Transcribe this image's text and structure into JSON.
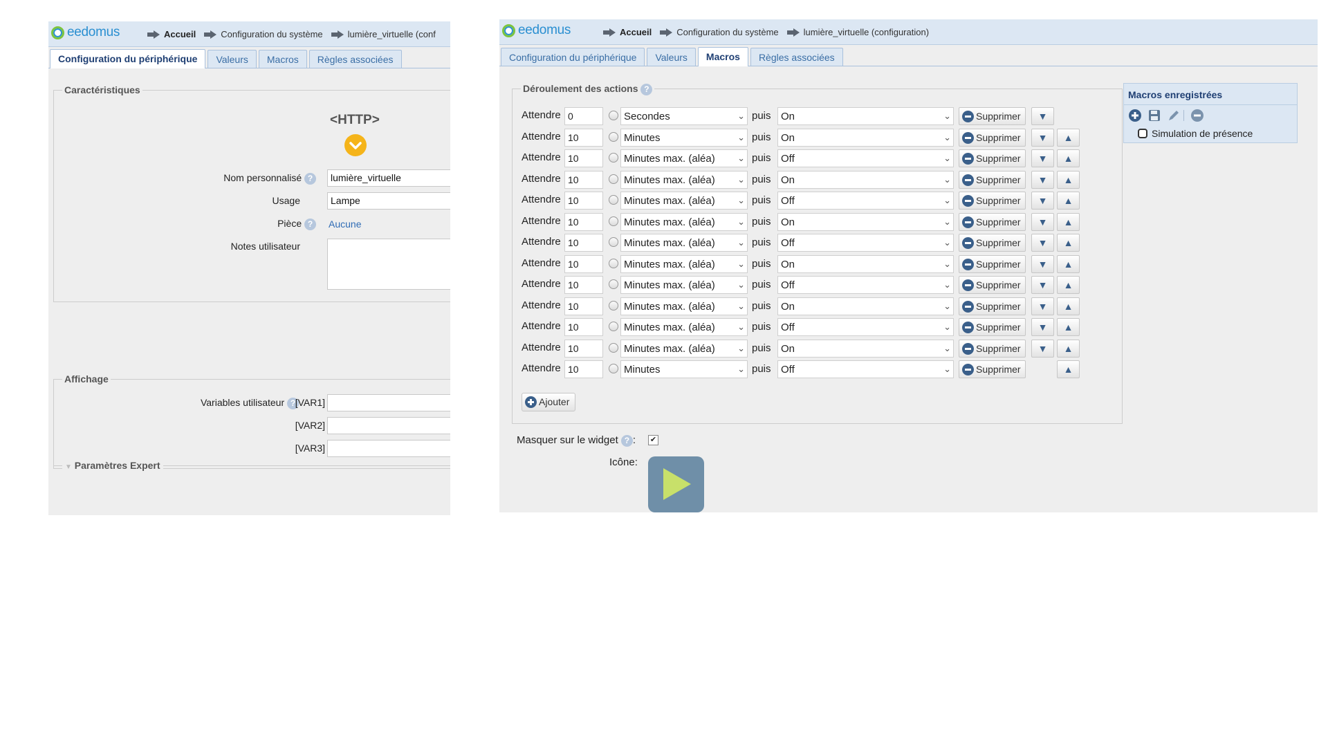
{
  "left": {
    "logo": "eedomus",
    "breadcrumbs": [
      "Accueil",
      "Configuration du système",
      "lumière_virtuelle (conf"
    ],
    "tabs": [
      "Configuration du périphérique",
      "Valeurs",
      "Macros",
      "Règles associées"
    ],
    "active_tab": 0,
    "section_characteristics": "Caractéristiques",
    "device_type": "<HTTP>",
    "fields": {
      "nom_label": "Nom personnalisé",
      "nom_value": "lumière_virtuelle",
      "usage_label": "Usage",
      "usage_value": "Lampe",
      "piece_label": "Pièce",
      "piece_value": "Aucune",
      "notes_label": "Notes utilisateur",
      "notes_value": ""
    },
    "section_display": "Affichage",
    "variables_label": "Variables utilisateur",
    "vars": [
      "[VAR1]",
      "[VAR2]",
      "[VAR3]"
    ],
    "expert_label": "Paramètres Expert",
    "help_glyph": "?"
  },
  "right": {
    "logo": "eedomus",
    "breadcrumbs": [
      "Accueil",
      "Configuration du système",
      "lumière_virtuelle (configuration)"
    ],
    "tabs": [
      "Configuration du périphérique",
      "Valeurs",
      "Macros",
      "Règles associées"
    ],
    "active_tab": 2,
    "section_actions": "Déroulement des actions",
    "actions": [
      {
        "wait": "Attendre",
        "value": "0",
        "unit": "Secondes",
        "then": "puis",
        "state": "On",
        "delete": "Supprimer",
        "down": true,
        "up": false
      },
      {
        "wait": "Attendre",
        "value": "10",
        "unit": "Minutes",
        "then": "puis",
        "state": "On",
        "delete": "Supprimer",
        "down": true,
        "up": true
      },
      {
        "wait": "Attendre",
        "value": "10",
        "unit": "Minutes max. (aléa)",
        "then": "puis",
        "state": "Off",
        "delete": "Supprimer",
        "down": true,
        "up": true
      },
      {
        "wait": "Attendre",
        "value": "10",
        "unit": "Minutes max. (aléa)",
        "then": "puis",
        "state": "On",
        "delete": "Supprimer",
        "down": true,
        "up": true
      },
      {
        "wait": "Attendre",
        "value": "10",
        "unit": "Minutes max. (aléa)",
        "then": "puis",
        "state": "Off",
        "delete": "Supprimer",
        "down": true,
        "up": true
      },
      {
        "wait": "Attendre",
        "value": "10",
        "unit": "Minutes max. (aléa)",
        "then": "puis",
        "state": "On",
        "delete": "Supprimer",
        "down": true,
        "up": true
      },
      {
        "wait": "Attendre",
        "value": "10",
        "unit": "Minutes max. (aléa)",
        "then": "puis",
        "state": "Off",
        "delete": "Supprimer",
        "down": true,
        "up": true
      },
      {
        "wait": "Attendre",
        "value": "10",
        "unit": "Minutes max. (aléa)",
        "then": "puis",
        "state": "On",
        "delete": "Supprimer",
        "down": true,
        "up": true
      },
      {
        "wait": "Attendre",
        "value": "10",
        "unit": "Minutes max. (aléa)",
        "then": "puis",
        "state": "Off",
        "delete": "Supprimer",
        "down": true,
        "up": true
      },
      {
        "wait": "Attendre",
        "value": "10",
        "unit": "Minutes max. (aléa)",
        "then": "puis",
        "state": "On",
        "delete": "Supprimer",
        "down": true,
        "up": true
      },
      {
        "wait": "Attendre",
        "value": "10",
        "unit": "Minutes max. (aléa)",
        "then": "puis",
        "state": "Off",
        "delete": "Supprimer",
        "down": true,
        "up": true
      },
      {
        "wait": "Attendre",
        "value": "10",
        "unit": "Minutes max. (aléa)",
        "then": "puis",
        "state": "On",
        "delete": "Supprimer",
        "down": true,
        "up": true
      },
      {
        "wait": "Attendre",
        "value": "10",
        "unit": "Minutes",
        "then": "puis",
        "state": "Off",
        "delete": "Supprimer",
        "down": false,
        "up": true
      }
    ],
    "add_label": "Ajouter",
    "hide_widget_label": "Masquer sur le widget",
    "hide_widget_checked": true,
    "icon_label": "Icône:",
    "macros_title": "Macros enregistrées",
    "macros": [
      "Simulation de présence"
    ],
    "help_glyph": "?",
    "colon": ":"
  },
  "icons": {
    "logo": "eedomus-ring-logo",
    "breadcrumb_arrow": "arrow-right-icon",
    "dropdown": "chevron-down-icon",
    "delete": "minus-circle-icon",
    "add": "plus-circle-icon",
    "move_down": "triangle-down-icon",
    "move_up": "triangle-up-icon",
    "save": "floppy-icon",
    "edit": "pencil-icon",
    "play": "play-icon"
  },
  "colors": {
    "header_bg": "#dce7f3",
    "panel_bg": "#eeeeee",
    "link": "#2f6cb5",
    "accent_orange": "#f5b41a",
    "play_bg": "#6f8fa8",
    "play_triangle": "#c8e06a"
  }
}
